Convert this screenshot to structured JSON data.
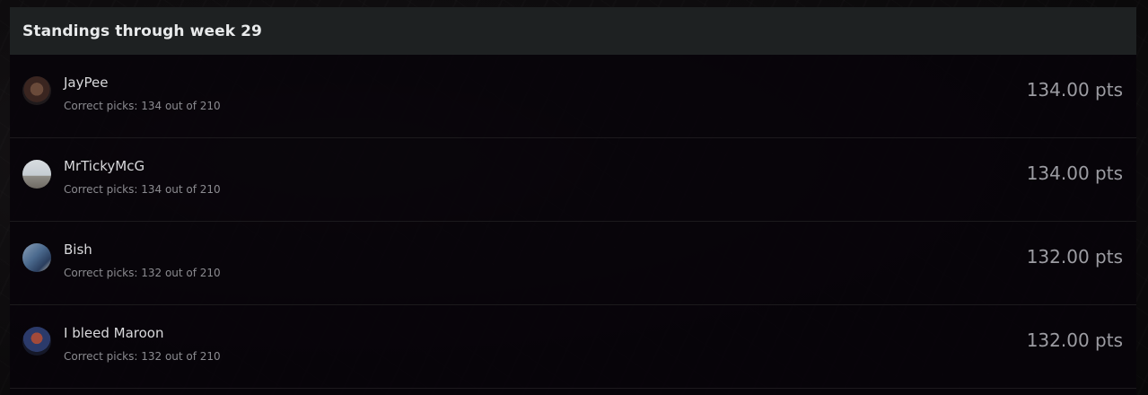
{
  "standings": {
    "title": "Standings through week 29",
    "rows": [
      {
        "name": "JayPee",
        "picks": "Correct picks: 134 out of 210",
        "points": "134.00 pts"
      },
      {
        "name": "MrTickyMcG",
        "picks": "Correct picks: 134 out of 210",
        "points": "134.00 pts"
      },
      {
        "name": "Bish",
        "picks": "Correct picks: 132 out of 210",
        "points": "132.00 pts"
      },
      {
        "name": "I bleed Maroon",
        "picks": "Correct picks: 132 out of 210",
        "points": "132.00 pts"
      }
    ]
  }
}
